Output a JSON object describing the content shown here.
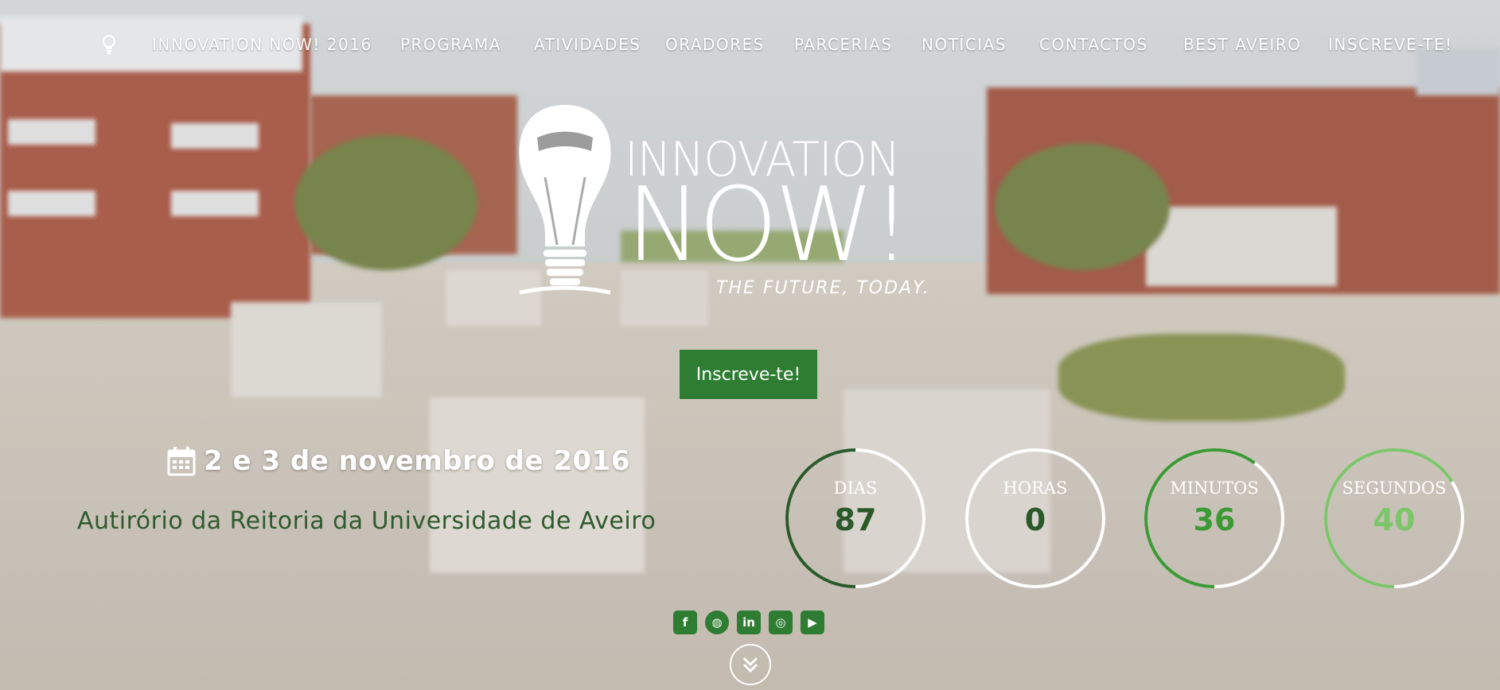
{
  "nav": {
    "items": [
      "INNOVATION NOW! 2016",
      "PROGRAMA",
      "ATIVIDADES",
      "ORADORES",
      "PARCERIAS",
      "NOTÍCIAS",
      "CONTACTOS",
      "BEST AVEIRO",
      "INSCREVE-TE!"
    ]
  },
  "logo": {
    "line1": "INNOVATION",
    "line2": "NOW!",
    "tagline": "THE FUTURE, TODAY."
  },
  "cta": {
    "label": "Inscreve-te!"
  },
  "event": {
    "date": "2 e 3 de novembro de 2016",
    "venue": "Autirório da Reitoria da Universidade de Aveiro"
  },
  "countdown": [
    {
      "label": "DIAS",
      "value": "87",
      "fraction": 0.5,
      "color": "#2b5a2a"
    },
    {
      "label": "HORAS",
      "value": "0",
      "fraction": 0.0,
      "color": "#2b5a2a"
    },
    {
      "label": "MINUTOS",
      "value": "36",
      "fraction": 0.6,
      "color": "#3c9a35"
    },
    {
      "label": "SEGUNDOS",
      "value": "40",
      "fraction": 0.66,
      "color": "#7cc56a"
    }
  ],
  "social": [
    {
      "icon": "facebook-icon",
      "glyph": "f"
    },
    {
      "icon": "globe-icon",
      "glyph": "◍"
    },
    {
      "icon": "linkedin-icon",
      "glyph": "in"
    },
    {
      "icon": "instagram-icon",
      "glyph": "◎"
    },
    {
      "icon": "youtube-icon",
      "glyph": "▶"
    }
  ],
  "colors": {
    "accent": "#2e7d32",
    "venue_text": "#2f5a2e"
  }
}
